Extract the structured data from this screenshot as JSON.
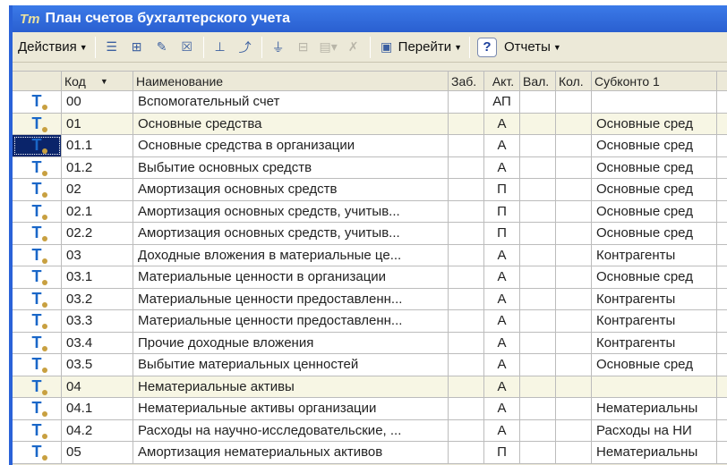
{
  "window": {
    "title": "План счетов бухгалтерского учета"
  },
  "toolbar": {
    "actions": "Действия",
    "goto": "Перейти",
    "help": "?",
    "reports": "Отчеты"
  },
  "columns": [
    "",
    "Код",
    "Наименование",
    "Заб.",
    "Акт.",
    "Вал.",
    "Кол.",
    "Субконто 1"
  ],
  "rows": [
    {
      "code": "00",
      "name": "Вспомогательный счет",
      "zab": "",
      "akt": "АП",
      "val": "",
      "kol": "",
      "sub1": "",
      "group": false
    },
    {
      "code": "01",
      "name": "Основные средства",
      "zab": "",
      "akt": "А",
      "val": "",
      "kol": "",
      "sub1": "Основные сред",
      "group": true
    },
    {
      "code": "01.1",
      "name": "Основные средства в организации",
      "zab": "",
      "akt": "А",
      "val": "",
      "kol": "",
      "sub1": "Основные сред",
      "group": false,
      "selected": true
    },
    {
      "code": "01.2",
      "name": "Выбытие основных средств",
      "zab": "",
      "akt": "А",
      "val": "",
      "kol": "",
      "sub1": "Основные сред",
      "group": false
    },
    {
      "code": "02",
      "name": "Амортизация основных средств",
      "zab": "",
      "akt": "П",
      "val": "",
      "kol": "",
      "sub1": "Основные сред",
      "group": false
    },
    {
      "code": "02.1",
      "name": "Амортизация основных средств, учитыв...",
      "zab": "",
      "akt": "П",
      "val": "",
      "kol": "",
      "sub1": "Основные сред",
      "group": false
    },
    {
      "code": "02.2",
      "name": "Амортизация основных средств, учитыв...",
      "zab": "",
      "akt": "П",
      "val": "",
      "kol": "",
      "sub1": "Основные сред",
      "group": false
    },
    {
      "code": "03",
      "name": "Доходные вложения в материальные це...",
      "zab": "",
      "akt": "А",
      "val": "",
      "kol": "",
      "sub1": "Контрагенты",
      "group": false
    },
    {
      "code": "03.1",
      "name": "Материальные ценности в организации",
      "zab": "",
      "akt": "А",
      "val": "",
      "kol": "",
      "sub1": "Основные сред",
      "group": false
    },
    {
      "code": "03.2",
      "name": "Материальные ценности предоставленн...",
      "zab": "",
      "akt": "А",
      "val": "",
      "kol": "",
      "sub1": "Контрагенты",
      "group": false
    },
    {
      "code": "03.3",
      "name": "Материальные ценности предоставленн...",
      "zab": "",
      "akt": "А",
      "val": "",
      "kol": "",
      "sub1": "Контрагенты",
      "group": false
    },
    {
      "code": "03.4",
      "name": "Прочие доходные вложения",
      "zab": "",
      "akt": "А",
      "val": "",
      "kol": "",
      "sub1": "Контрагенты",
      "group": false
    },
    {
      "code": "03.5",
      "name": "Выбытие материальных ценностей",
      "zab": "",
      "akt": "А",
      "val": "",
      "kol": "",
      "sub1": "Основные сред",
      "group": false
    },
    {
      "code": "04",
      "name": "Нематериальные активы",
      "zab": "",
      "akt": "А",
      "val": "",
      "kol": "",
      "sub1": "",
      "group": true
    },
    {
      "code": "04.1",
      "name": "Нематериальные активы организации",
      "zab": "",
      "akt": "А",
      "val": "",
      "kol": "",
      "sub1": "Нематериальны",
      "group": false
    },
    {
      "code": "04.2",
      "name": "Расходы на научно-исследовательские, ...",
      "zab": "",
      "akt": "А",
      "val": "",
      "kol": "",
      "sub1": "Расходы на НИ",
      "group": false
    },
    {
      "code": "05",
      "name": "Амортизация нематериальных активов",
      "zab": "",
      "akt": "П",
      "val": "",
      "kol": "",
      "sub1": "Нематериальны",
      "group": false
    }
  ]
}
